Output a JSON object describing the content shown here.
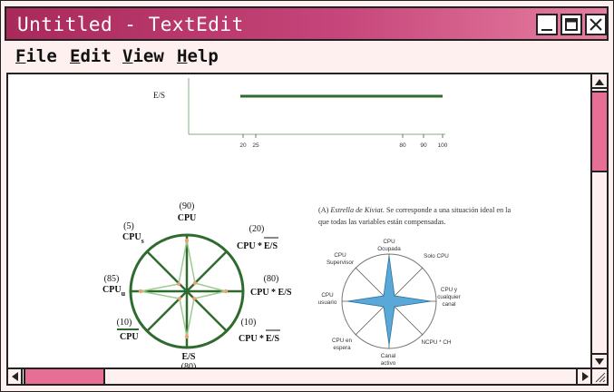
{
  "window": {
    "title": "Untitled - TextEdit",
    "accent": "#c6457a"
  },
  "menu": {
    "items": [
      {
        "label": "File",
        "key": "F",
        "rest": "ile"
      },
      {
        "label": "Edit",
        "key": "E",
        "rest": "dit"
      },
      {
        "label": "View",
        "key": "V",
        "rest": "iew"
      },
      {
        "label": "Help",
        "key": "H",
        "rest": "elp"
      }
    ]
  },
  "document": {
    "top_chart": {
      "row_label": "E/S",
      "bar_start": 20,
      "bar_end": 100,
      "ticks": [
        "20",
        "25",
        "80",
        "90",
        "100"
      ],
      "bar_color": "#2f6b2f"
    },
    "kiviat_left": {
      "labels": {
        "top_value": "(90)",
        "top": "CPU",
        "tl_value": "(5)",
        "tl_main": "CPU",
        "tl_sub": "s",
        "tr_value": "(20)",
        "tr_main": "CPU *",
        "tr_over": "E/S",
        "l_value": "(85)",
        "l_main": "CPU",
        "l_sub": "u",
        "r_value": "(80)",
        "r_main": "CPU * E/S",
        "bl_value": "(10)",
        "bl_main": "CPU",
        "br_value": "(10)",
        "br_main": "CPU *",
        "br_over": "E/S",
        "bottom": "E/S",
        "bottom_value": "(80)"
      },
      "circle_color": "#2f6b2f"
    },
    "caption": {
      "prefix": "(A) ",
      "italic": "Estrella de Kiviat.",
      "line1_rest": " Se corresponde a una situación ideal en la",
      "line2": "que todas las variables están compensadas."
    },
    "kiviat_right": {
      "labels": {
        "top1": "CPU",
        "top2": "Ocupada",
        "tr": "Solo CPU",
        "r1": "CPU y",
        "r2": "cualquier",
        "r3": "canal",
        "br": "NCPU * CH",
        "b1": "Canal",
        "b2": "activo",
        "bl1": "CPU en",
        "bl2": "espera",
        "l1": "CPU",
        "l2": "usuario",
        "tl1": "CPU",
        "tl2": "Supervisor"
      },
      "fill_color": "#5aa8d8"
    }
  },
  "scrollbars": {
    "vertical_position": 0.0,
    "horizontal_position": 0.0,
    "thumb_color": "#e76f95"
  }
}
